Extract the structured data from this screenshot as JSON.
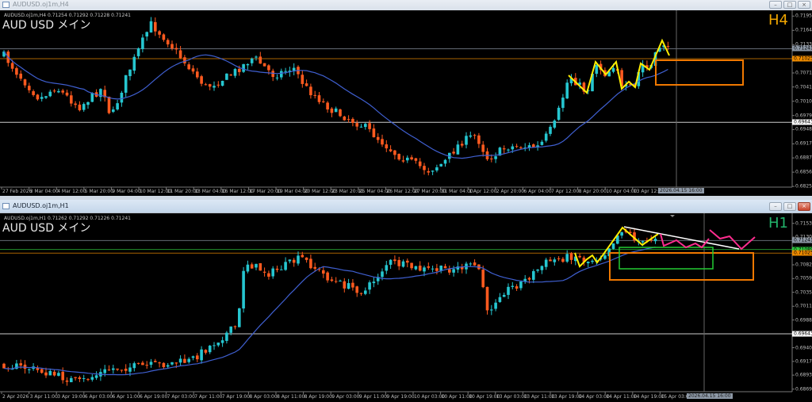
{
  "windows": [
    {
      "title": "AUDUSD.oj1m,H4",
      "symbol_info": "AUDUSD.oj1m,H4  0.71254 0.71292 0.71228 0.71241",
      "chart_title": "AUD USD  メイン",
      "timeframe": "H4",
      "timeframe_color": "#f0a500",
      "active": false,
      "price_axis": [
        "0.71950",
        "0.71640",
        "0.71330",
        "0.70715",
        "0.70410",
        "0.70100",
        "0.69790",
        "0.69485",
        "0.69175",
        "0.68870",
        "0.68560",
        "0.68250"
      ],
      "price_markers": [
        {
          "value": "0.71241",
          "color": "#8d98a6"
        },
        {
          "value": "0.71025",
          "color": "#f08c00"
        },
        {
          "value": "0.69643",
          "color": "#ffffff"
        }
      ],
      "time_axis": [
        "27 Feb 2026",
        "3 Mar 04:00",
        "4 Mar 12:00",
        "5 Mar 20:00",
        "9 Mar 04:00",
        "10 Mar 12:00",
        "11 Mar 20:00",
        "13 Mar 04:00",
        "16 Mar 12:00",
        "17 Mar 20:00",
        "19 Mar 04:00",
        "20 Mar 12:00",
        "23 Mar 20:00",
        "25 Mar 04:00",
        "26 Mar 12:00",
        "27 Mar 20:00",
        "31 Mar 04:00",
        "1 Apr 12:00",
        "2 Apr 20:00",
        "6 Apr 04:00",
        "7 Apr 12:00",
        "8 Apr 20:00",
        "10 Apr 04:00",
        "13 Apr 12:00"
      ],
      "cursor_time": "2026.04.15 16:00"
    },
    {
      "title": "AUDUSD.oj1m,H1",
      "symbol_info": "AUDUSD.oj1m,H1  0.71262 0.71292 0.71226 0.71241",
      "chart_title": "AUD USD  メイン",
      "timeframe": "H1",
      "timeframe_color": "#22b36b",
      "active": true,
      "price_axis": [
        "0.71535",
        "0.71300",
        "0.70825",
        "0.70590",
        "0.70355",
        "0.70115",
        "0.69880",
        "0.69405",
        "0.69170",
        "0.68935",
        "0.68695"
      ],
      "price_markers": [
        {
          "value": "0.71241",
          "color": "#8d98a6"
        },
        {
          "value": "0.71089",
          "color": "#2ecc40"
        },
        {
          "value": "0.71025",
          "color": "#f08c00"
        },
        {
          "value": "0.69643",
          "color": "#ffffff"
        }
      ],
      "time_axis": [
        "2 Apr 2026",
        "3 Apr 11:00",
        "3 Apr 19:00",
        "6 Apr 03:00",
        "6 Apr 11:00",
        "6 Apr 19:00",
        "7 Apr 03:00",
        "7 Apr 11:00",
        "7 Apr 19:00",
        "8 Apr 03:00",
        "8 Apr 11:00",
        "8 Apr 19:00",
        "9 Apr 03:00",
        "9 Apr 11:00",
        "9 Apr 19:00",
        "10 Apr 03:00",
        "10 Apr 11:00",
        "10 Apr 19:00",
        "13 Apr 03:00",
        "13 Apr 11:00",
        "13 Apr 19:00",
        "14 Apr 03:00",
        "14 Apr 11:00",
        "14 Apr 19:00",
        "15 Apr 03:00"
      ],
      "cursor_time": "2026.04.15 16:00"
    }
  ],
  "colors": {
    "bull": "#26c6d0",
    "bear": "#ff5a1f",
    "ma": "#3f5fd0",
    "zigzag": "#ffee00",
    "projection": "#ff2d8f",
    "trendline": "#ffffff",
    "zone_orange": "#f07800",
    "zone_green": "#22cc33"
  },
  "window_buttons": {
    "minimize": "–",
    "maximize": "□",
    "close": "×"
  }
}
